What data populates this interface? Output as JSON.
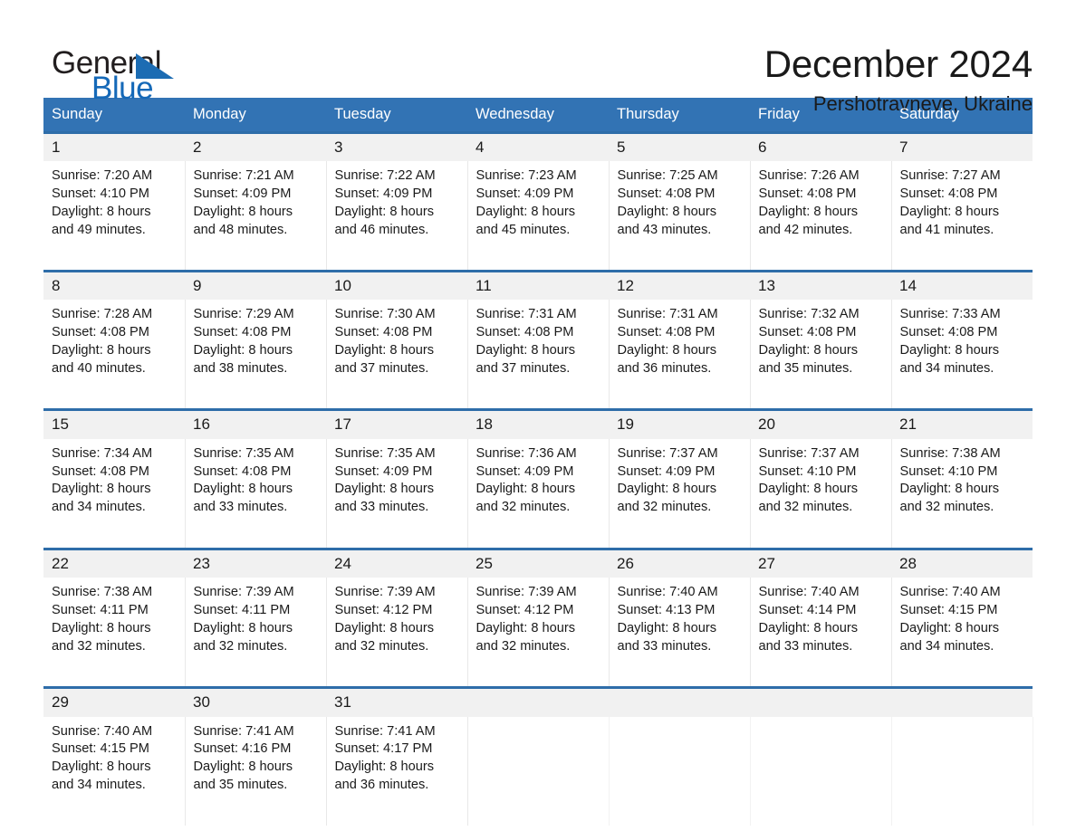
{
  "brand": {
    "name_part1": "General",
    "name_part2": "Blue",
    "accent_color": "#1569b8",
    "triangle_color": "#1c6cb3"
  },
  "header": {
    "title": "December 2024",
    "location": "Pershotravneve, Ukraine"
  },
  "calendar": {
    "header_bg": "#3273b4",
    "date_band_bg": "#f1f1f1",
    "rule_color": "#2e6da9",
    "weekday_headers": [
      "Sunday",
      "Monday",
      "Tuesday",
      "Wednesday",
      "Thursday",
      "Friday",
      "Saturday"
    ],
    "weeks": [
      [
        {
          "date": "1",
          "sunrise": "Sunrise: 7:20 AM",
          "sunset": "Sunset: 4:10 PM",
          "daylight_line1": "Daylight: 8 hours",
          "daylight_line2": "and 49 minutes."
        },
        {
          "date": "2",
          "sunrise": "Sunrise: 7:21 AM",
          "sunset": "Sunset: 4:09 PM",
          "daylight_line1": "Daylight: 8 hours",
          "daylight_line2": "and 48 minutes."
        },
        {
          "date": "3",
          "sunrise": "Sunrise: 7:22 AM",
          "sunset": "Sunset: 4:09 PM",
          "daylight_line1": "Daylight: 8 hours",
          "daylight_line2": "and 46 minutes."
        },
        {
          "date": "4",
          "sunrise": "Sunrise: 7:23 AM",
          "sunset": "Sunset: 4:09 PM",
          "daylight_line1": "Daylight: 8 hours",
          "daylight_line2": "and 45 minutes."
        },
        {
          "date": "5",
          "sunrise": "Sunrise: 7:25 AM",
          "sunset": "Sunset: 4:08 PM",
          "daylight_line1": "Daylight: 8 hours",
          "daylight_line2": "and 43 minutes."
        },
        {
          "date": "6",
          "sunrise": "Sunrise: 7:26 AM",
          "sunset": "Sunset: 4:08 PM",
          "daylight_line1": "Daylight: 8 hours",
          "daylight_line2": "and 42 minutes."
        },
        {
          "date": "7",
          "sunrise": "Sunrise: 7:27 AM",
          "sunset": "Sunset: 4:08 PM",
          "daylight_line1": "Daylight: 8 hours",
          "daylight_line2": "and 41 minutes."
        }
      ],
      [
        {
          "date": "8",
          "sunrise": "Sunrise: 7:28 AM",
          "sunset": "Sunset: 4:08 PM",
          "daylight_line1": "Daylight: 8 hours",
          "daylight_line2": "and 40 minutes."
        },
        {
          "date": "9",
          "sunrise": "Sunrise: 7:29 AM",
          "sunset": "Sunset: 4:08 PM",
          "daylight_line1": "Daylight: 8 hours",
          "daylight_line2": "and 38 minutes."
        },
        {
          "date": "10",
          "sunrise": "Sunrise: 7:30 AM",
          "sunset": "Sunset: 4:08 PM",
          "daylight_line1": "Daylight: 8 hours",
          "daylight_line2": "and 37 minutes."
        },
        {
          "date": "11",
          "sunrise": "Sunrise: 7:31 AM",
          "sunset": "Sunset: 4:08 PM",
          "daylight_line1": "Daylight: 8 hours",
          "daylight_line2": "and 37 minutes."
        },
        {
          "date": "12",
          "sunrise": "Sunrise: 7:31 AM",
          "sunset": "Sunset: 4:08 PM",
          "daylight_line1": "Daylight: 8 hours",
          "daylight_line2": "and 36 minutes."
        },
        {
          "date": "13",
          "sunrise": "Sunrise: 7:32 AM",
          "sunset": "Sunset: 4:08 PM",
          "daylight_line1": "Daylight: 8 hours",
          "daylight_line2": "and 35 minutes."
        },
        {
          "date": "14",
          "sunrise": "Sunrise: 7:33 AM",
          "sunset": "Sunset: 4:08 PM",
          "daylight_line1": "Daylight: 8 hours",
          "daylight_line2": "and 34 minutes."
        }
      ],
      [
        {
          "date": "15",
          "sunrise": "Sunrise: 7:34 AM",
          "sunset": "Sunset: 4:08 PM",
          "daylight_line1": "Daylight: 8 hours",
          "daylight_line2": "and 34 minutes."
        },
        {
          "date": "16",
          "sunrise": "Sunrise: 7:35 AM",
          "sunset": "Sunset: 4:08 PM",
          "daylight_line1": "Daylight: 8 hours",
          "daylight_line2": "and 33 minutes."
        },
        {
          "date": "17",
          "sunrise": "Sunrise: 7:35 AM",
          "sunset": "Sunset: 4:09 PM",
          "daylight_line1": "Daylight: 8 hours",
          "daylight_line2": "and 33 minutes."
        },
        {
          "date": "18",
          "sunrise": "Sunrise: 7:36 AM",
          "sunset": "Sunset: 4:09 PM",
          "daylight_line1": "Daylight: 8 hours",
          "daylight_line2": "and 32 minutes."
        },
        {
          "date": "19",
          "sunrise": "Sunrise: 7:37 AM",
          "sunset": "Sunset: 4:09 PM",
          "daylight_line1": "Daylight: 8 hours",
          "daylight_line2": "and 32 minutes."
        },
        {
          "date": "20",
          "sunrise": "Sunrise: 7:37 AM",
          "sunset": "Sunset: 4:10 PM",
          "daylight_line1": "Daylight: 8 hours",
          "daylight_line2": "and 32 minutes."
        },
        {
          "date": "21",
          "sunrise": "Sunrise: 7:38 AM",
          "sunset": "Sunset: 4:10 PM",
          "daylight_line1": "Daylight: 8 hours",
          "daylight_line2": "and 32 minutes."
        }
      ],
      [
        {
          "date": "22",
          "sunrise": "Sunrise: 7:38 AM",
          "sunset": "Sunset: 4:11 PM",
          "daylight_line1": "Daylight: 8 hours",
          "daylight_line2": "and 32 minutes."
        },
        {
          "date": "23",
          "sunrise": "Sunrise: 7:39 AM",
          "sunset": "Sunset: 4:11 PM",
          "daylight_line1": "Daylight: 8 hours",
          "daylight_line2": "and 32 minutes."
        },
        {
          "date": "24",
          "sunrise": "Sunrise: 7:39 AM",
          "sunset": "Sunset: 4:12 PM",
          "daylight_line1": "Daylight: 8 hours",
          "daylight_line2": "and 32 minutes."
        },
        {
          "date": "25",
          "sunrise": "Sunrise: 7:39 AM",
          "sunset": "Sunset: 4:12 PM",
          "daylight_line1": "Daylight: 8 hours",
          "daylight_line2": "and 32 minutes."
        },
        {
          "date": "26",
          "sunrise": "Sunrise: 7:40 AM",
          "sunset": "Sunset: 4:13 PM",
          "daylight_line1": "Daylight: 8 hours",
          "daylight_line2": "and 33 minutes."
        },
        {
          "date": "27",
          "sunrise": "Sunrise: 7:40 AM",
          "sunset": "Sunset: 4:14 PM",
          "daylight_line1": "Daylight: 8 hours",
          "daylight_line2": "and 33 minutes."
        },
        {
          "date": "28",
          "sunrise": "Sunrise: 7:40 AM",
          "sunset": "Sunset: 4:15 PM",
          "daylight_line1": "Daylight: 8 hours",
          "daylight_line2": "and 34 minutes."
        }
      ],
      [
        {
          "date": "29",
          "sunrise": "Sunrise: 7:40 AM",
          "sunset": "Sunset: 4:15 PM",
          "daylight_line1": "Daylight: 8 hours",
          "daylight_line2": "and 34 minutes."
        },
        {
          "date": "30",
          "sunrise": "Sunrise: 7:41 AM",
          "sunset": "Sunset: 4:16 PM",
          "daylight_line1": "Daylight: 8 hours",
          "daylight_line2": "and 35 minutes."
        },
        {
          "date": "31",
          "sunrise": "Sunrise: 7:41 AM",
          "sunset": "Sunset: 4:17 PM",
          "daylight_line1": "Daylight: 8 hours",
          "daylight_line2": "and 36 minutes."
        },
        {
          "date": "",
          "sunrise": "",
          "sunset": "",
          "daylight_line1": "",
          "daylight_line2": ""
        },
        {
          "date": "",
          "sunrise": "",
          "sunset": "",
          "daylight_line1": "",
          "daylight_line2": ""
        },
        {
          "date": "",
          "sunrise": "",
          "sunset": "",
          "daylight_line1": "",
          "daylight_line2": ""
        },
        {
          "date": "",
          "sunrise": "",
          "sunset": "",
          "daylight_line1": "",
          "daylight_line2": ""
        }
      ]
    ]
  }
}
